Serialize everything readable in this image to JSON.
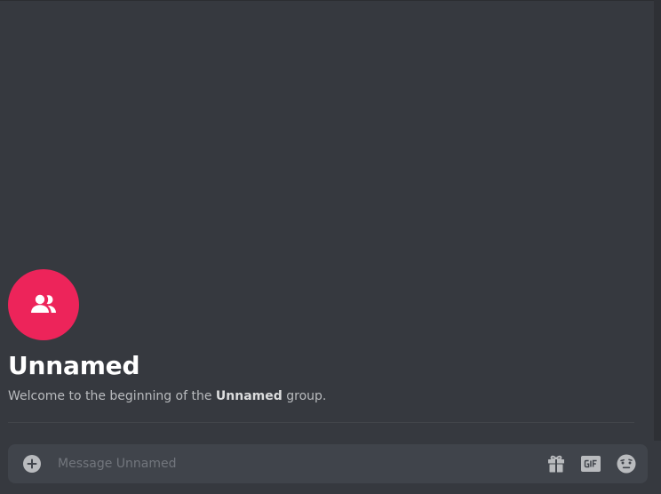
{
  "channel": {
    "name": "Unnamed",
    "welcome_prefix": "Welcome to the beginning of the ",
    "welcome_bold": "Unnamed",
    "welcome_suffix": " group."
  },
  "composer": {
    "placeholder": "Message Unnamed",
    "value": ""
  },
  "icons": {
    "avatar": "group-users-icon",
    "attach": "add-circle-icon",
    "gift": "gift-icon",
    "gif": "gif-icon",
    "emoji": "emoji-icon"
  },
  "colors": {
    "background": "#36393f",
    "avatar": "#ed245a",
    "composer": "#40444b",
    "icon": "#b9bbbe"
  }
}
